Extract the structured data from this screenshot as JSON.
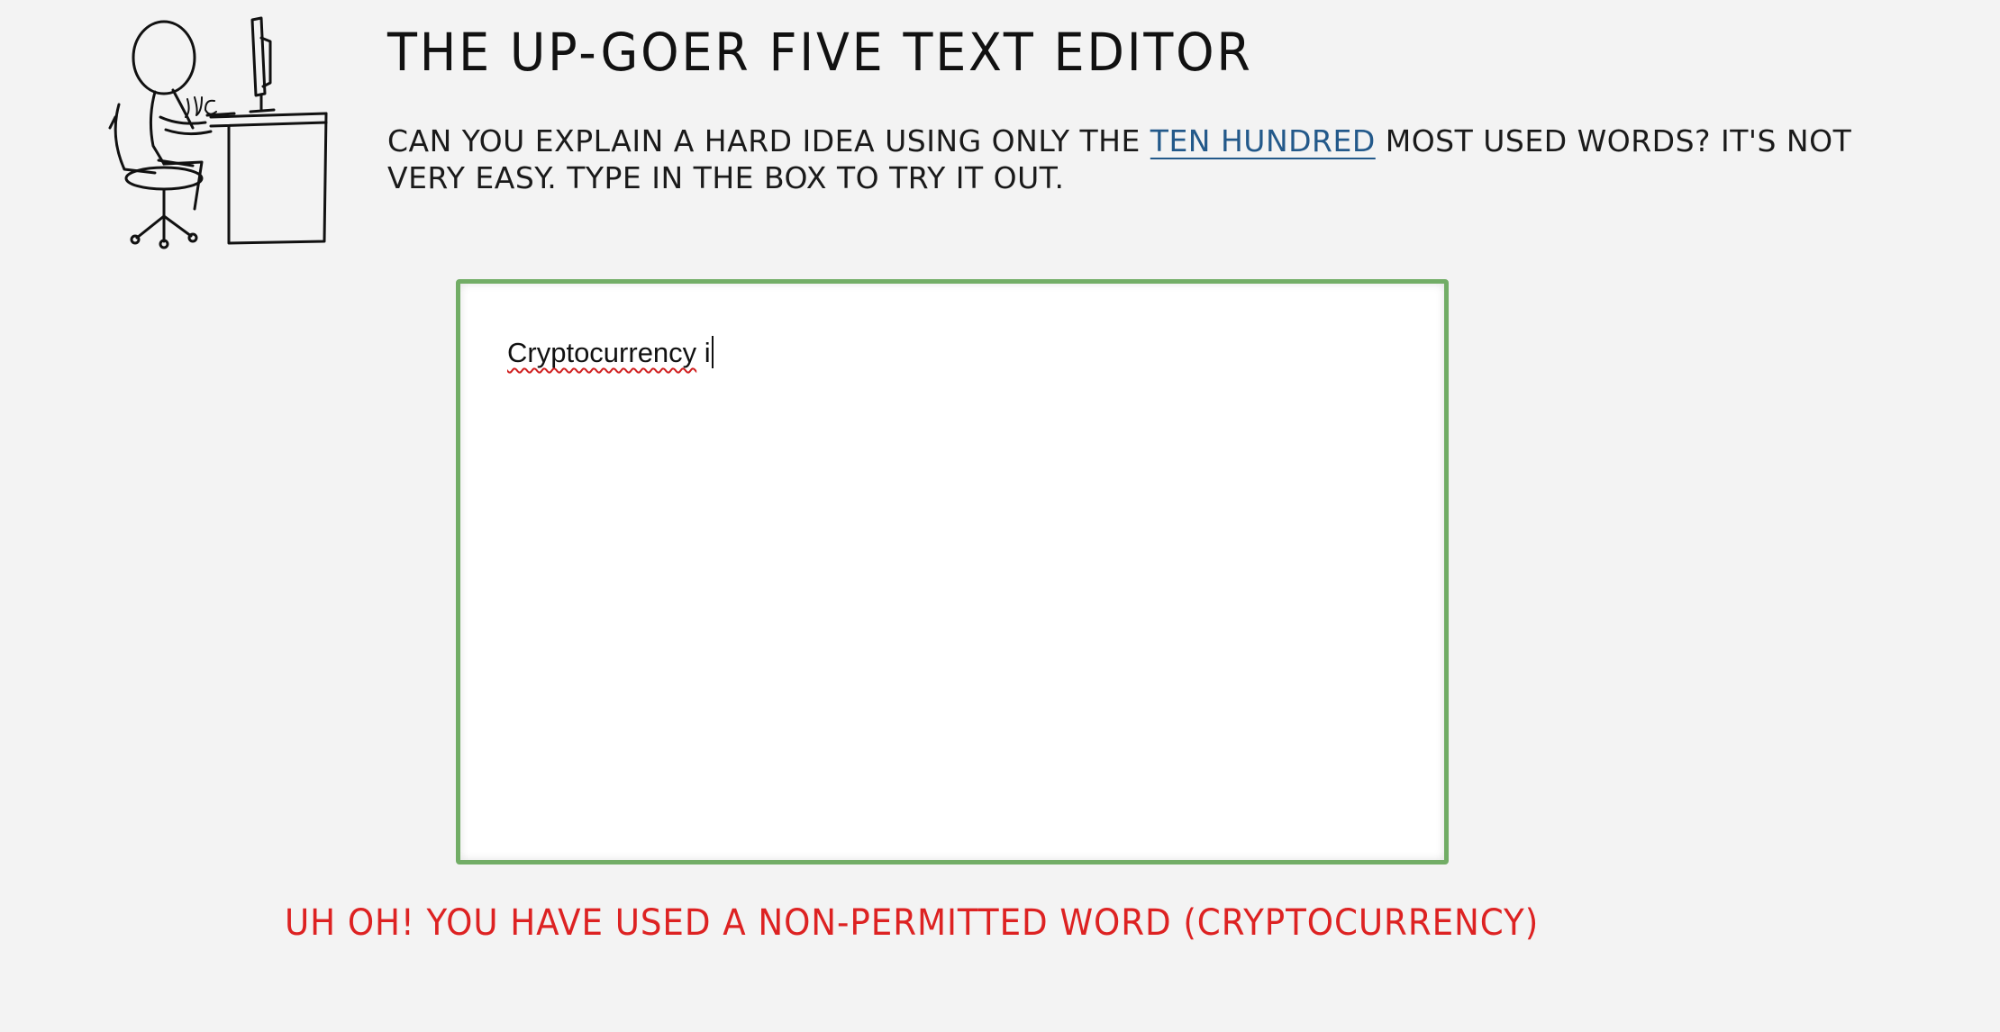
{
  "header": {
    "title": "THE UP-GOER FIVE TEXT EDITOR"
  },
  "intro": {
    "before_link": "CAN YOU EXPLAIN A HARD IDEA USING ONLY THE ",
    "link_text": "TEN HUNDRED",
    "after_link": " MOST USED WORDS? IT'S NOT VERY EASY. TYPE IN THE BOX TO TRY IT OUT."
  },
  "editor": {
    "misspelled_word": "Cryptocurrency",
    "trailing_text": " i"
  },
  "message": {
    "error_text": "UH OH! YOU HAVE USED A NON-PERMITTED WORD (CRYPTOCURRENCY)"
  },
  "colors": {
    "background": "#f3f3f3",
    "editor_border": "#72ad66",
    "link": "#23598a",
    "error": "#dd2222",
    "spellcheck_underline": "#d02020"
  },
  "illustration": {
    "icon": "stick-figure-at-desk-illustration",
    "squiggle_text": "JUC"
  }
}
